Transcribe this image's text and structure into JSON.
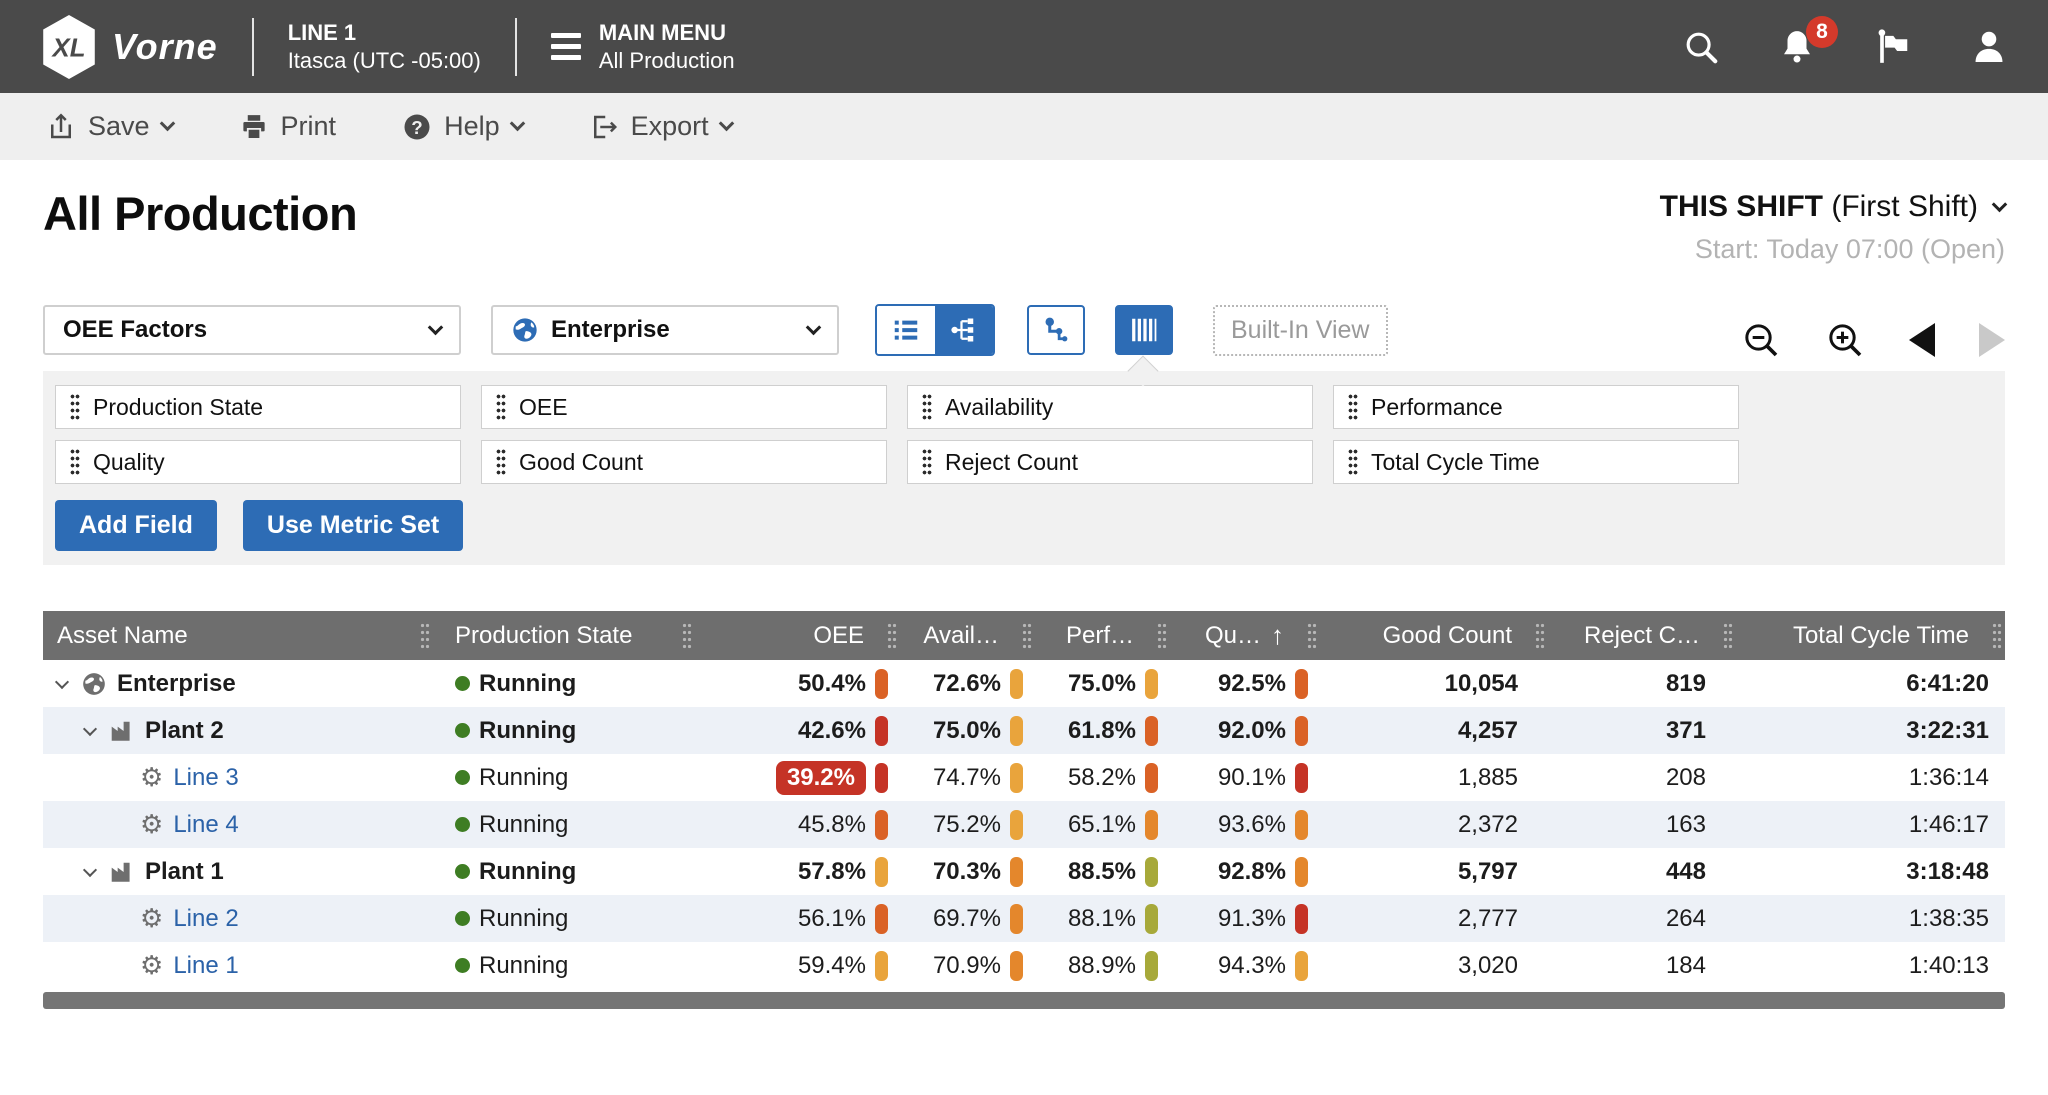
{
  "topbar": {
    "logo_text": "XL",
    "brand": "Vorne",
    "device": {
      "title": "LINE 1",
      "subtitle": "Itasca (UTC -05:00)"
    },
    "menu": {
      "title": "MAIN MENU",
      "subtitle": "All Production"
    },
    "notification_count": "8"
  },
  "toolbar": {
    "save_label": "Save",
    "print_label": "Print",
    "help_label": "Help",
    "export_label": "Export"
  },
  "page": {
    "title": "All Production",
    "period_label": "THIS SHIFT",
    "period_detail": "(First Shift)",
    "period_start": "Start: Today 07:00 (Open)"
  },
  "controls": {
    "metric_set_value": "OEE Factors",
    "scope_value": "Enterprise",
    "built_in_view_label": "Built-In View",
    "add_field_label": "Add Field",
    "use_metric_set_label": "Use Metric Set",
    "fields": [
      "Production State",
      "OEE",
      "Availability",
      "Performance",
      "Quality",
      "Good Count",
      "Reject Count",
      "Total Cycle Time"
    ]
  },
  "colors": {
    "accent": "#2d6cb5",
    "link": "#2b62a8",
    "running_green": "#3e7d23",
    "red": "#c53326",
    "orange": "#da6226",
    "light_orange": "#e4872c",
    "amber": "#e9a43c",
    "olive": "#a7a93a"
  },
  "table": {
    "columns": {
      "asset": "Asset Name",
      "state": "Production State",
      "oee": "OEE",
      "avail": "Avail…",
      "perf": "Perf…",
      "quality": "Qu…",
      "good": "Good Count",
      "reject": "Reject C…",
      "cycle": "Total Cycle Time"
    },
    "sort_indicator": "↑",
    "rows": [
      {
        "name": "Enterprise",
        "state": "Running",
        "oee": {
          "v": "50.4%",
          "c": "#da6226"
        },
        "avail": {
          "v": "72.6%",
          "c": "#e9a43c"
        },
        "perf": {
          "v": "75.0%",
          "c": "#e9a43c"
        },
        "qual": {
          "v": "92.5%",
          "c": "#da6226"
        },
        "good": "10,054",
        "reject": "819",
        "cycle": "6:41:20"
      },
      {
        "name": "Plant 2",
        "state": "Running",
        "oee": {
          "v": "42.6%",
          "c": "#c53326"
        },
        "avail": {
          "v": "75.0%",
          "c": "#e9a43c"
        },
        "perf": {
          "v": "61.8%",
          "c": "#da6226"
        },
        "qual": {
          "v": "92.0%",
          "c": "#da6226"
        },
        "good": "4,257",
        "reject": "371",
        "cycle": "3:22:31"
      },
      {
        "name": "Line 3",
        "state": "Running",
        "oee": {
          "v": "39.2%",
          "c": "#c53326"
        },
        "avail": {
          "v": "74.7%",
          "c": "#e9a43c"
        },
        "perf": {
          "v": "58.2%",
          "c": "#da6226"
        },
        "qual": {
          "v": "90.1%",
          "c": "#c53326"
        },
        "good": "1,885",
        "reject": "208",
        "cycle": "1:36:14"
      },
      {
        "name": "Line 4",
        "state": "Running",
        "oee": {
          "v": "45.8%",
          "c": "#da6226"
        },
        "avail": {
          "v": "75.2%",
          "c": "#e9a43c"
        },
        "perf": {
          "v": "65.1%",
          "c": "#e4872c"
        },
        "qual": {
          "v": "93.6%",
          "c": "#e4872c"
        },
        "good": "2,372",
        "reject": "163",
        "cycle": "1:46:17"
      },
      {
        "name": "Plant 1",
        "state": "Running",
        "oee": {
          "v": "57.8%",
          "c": "#e9a43c"
        },
        "avail": {
          "v": "70.3%",
          "c": "#e4872c"
        },
        "perf": {
          "v": "88.5%",
          "c": "#a7a93a"
        },
        "qual": {
          "v": "92.8%",
          "c": "#e4872c"
        },
        "good": "5,797",
        "reject": "448",
        "cycle": "3:18:48"
      },
      {
        "name": "Line 2",
        "state": "Running",
        "oee": {
          "v": "56.1%",
          "c": "#da6226"
        },
        "avail": {
          "v": "69.7%",
          "c": "#e4872c"
        },
        "perf": {
          "v": "88.1%",
          "c": "#a7a93a"
        },
        "qual": {
          "v": "91.3%",
          "c": "#c53326"
        },
        "good": "2,777",
        "reject": "264",
        "cycle": "1:38:35"
      },
      {
        "name": "Line 1",
        "state": "Running",
        "oee": {
          "v": "59.4%",
          "c": "#e9a43c"
        },
        "avail": {
          "v": "70.9%",
          "c": "#e4872c"
        },
        "perf": {
          "v": "88.9%",
          "c": "#a7a93a"
        },
        "qual": {
          "v": "94.3%",
          "c": "#e9a43c"
        },
        "good": "3,020",
        "reject": "184",
        "cycle": "1:40:13"
      }
    ]
  }
}
